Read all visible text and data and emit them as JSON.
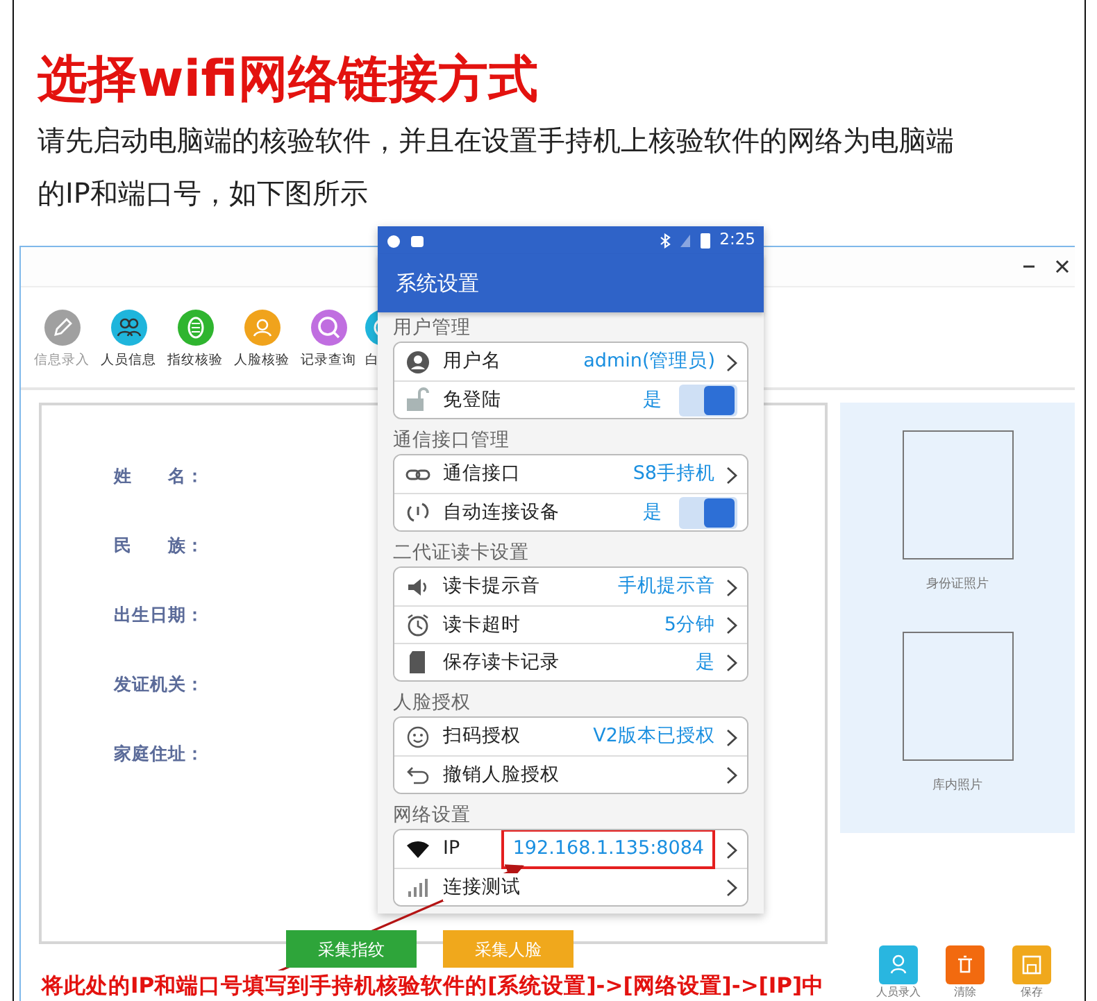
{
  "heading": "选择wifi网络链接方式",
  "intro": "请先启动电脑端的核验软件，并且在设置手持机上核验软件的网络为电脑端的IP和端口号，如下图所示",
  "desktop": {
    "toolbar": [
      {
        "label": "信息录入",
        "color": "#a0a0a0",
        "disabled": true
      },
      {
        "label": "人员信息",
        "color": "#1fb5dc",
        "disabled": false
      },
      {
        "label": "指纹核验",
        "color": "#2fb52f",
        "disabled": false
      },
      {
        "label": "人脸核验",
        "color": "#f0a31c",
        "disabled": false
      },
      {
        "label": "记录查询",
        "color": "#c06ee0",
        "disabled": false
      },
      {
        "label": "白",
        "color": "#1fb5dc",
        "disabled": false
      }
    ],
    "form_fields": [
      "姓　　名：",
      "民　　族：",
      "出生日期：",
      "发证机关：",
      "家庭住址："
    ],
    "photo_slots": [
      "身份证照片",
      "库内照片"
    ],
    "buttons": [
      {
        "label": "采集指纹",
        "color": "#2ea53a"
      },
      {
        "label": "采集人脸",
        "color": "#f0a81c"
      }
    ],
    "actions": [
      {
        "label": "人员录入",
        "color": "#29b6e0"
      },
      {
        "label": "清除",
        "color": "#f26a0f"
      },
      {
        "label": "保存",
        "color": "#f0a81c"
      }
    ]
  },
  "phone": {
    "time": "2:25",
    "title": "系统设置",
    "groups": [
      {
        "title": "用户管理",
        "items": [
          {
            "kind": "link",
            "label": "用户名",
            "value": "admin(管理员)"
          },
          {
            "kind": "switch",
            "label": "免登陆",
            "value": "是",
            "on": true
          }
        ]
      },
      {
        "title": "通信接口管理",
        "items": [
          {
            "kind": "link",
            "label": "通信接口",
            "value": "S8手持机"
          },
          {
            "kind": "switch",
            "label": "自动连接设备",
            "value": "是",
            "on": true
          }
        ]
      },
      {
        "title": "二代证读卡设置",
        "items": [
          {
            "kind": "link",
            "label": "读卡提示音",
            "value": "手机提示音"
          },
          {
            "kind": "link",
            "label": "读卡超时",
            "value": "5分钟"
          },
          {
            "kind": "link",
            "label": "保存读卡记录",
            "value": "是"
          }
        ]
      },
      {
        "title": "人脸授权",
        "items": [
          {
            "kind": "link",
            "label": "扫码授权",
            "value": "V2版本已授权"
          },
          {
            "kind": "link",
            "label": "撤销人脸授权"
          }
        ]
      },
      {
        "title": "网络设置",
        "items": [
          {
            "kind": "link",
            "label": "IP",
            "value": "192.168.1.135:8084",
            "highlighted": true
          },
          {
            "kind": "link",
            "label": "连接测试"
          }
        ]
      }
    ]
  },
  "caption": "将此处的IP和端口号填写到手持机核验软件的[系统设置]->[网络设置]->[IP]中"
}
